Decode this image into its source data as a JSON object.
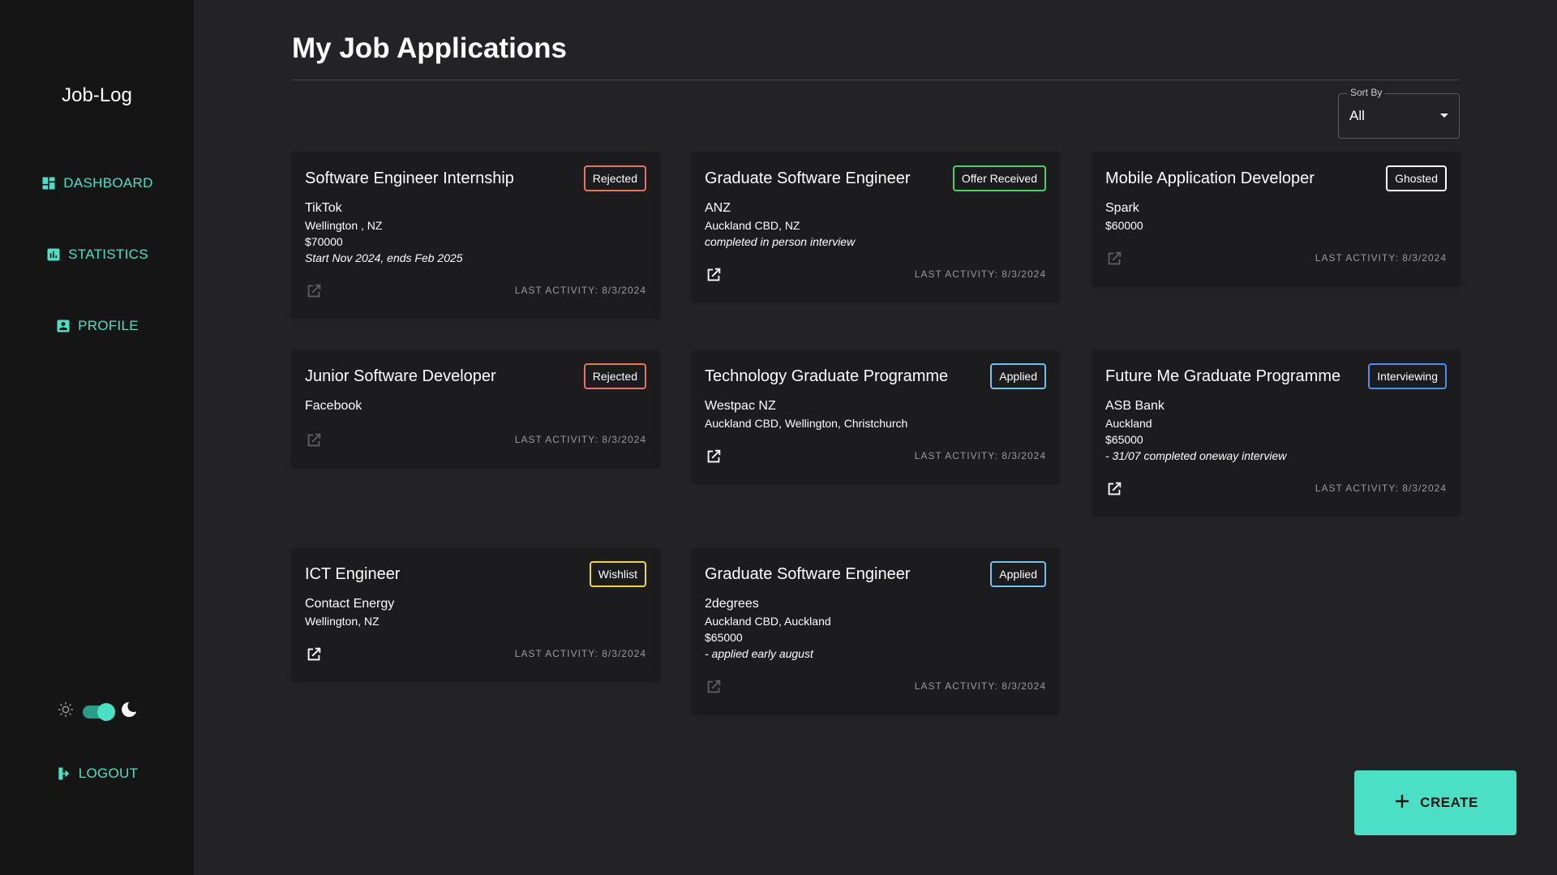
{
  "sidebar": {
    "brand": "Job-Log",
    "nav": [
      {
        "label": "DASHBOARD",
        "icon": "dashboard-icon"
      },
      {
        "label": "STATISTICS",
        "icon": "chart-icon"
      },
      {
        "label": "PROFILE",
        "icon": "account-box-icon"
      }
    ],
    "theme_toggle": {
      "left_icon": "sun-icon",
      "right_icon": "moon-icon",
      "dark_mode": true
    },
    "logout": {
      "label": "LOGOUT",
      "icon": "logout-icon"
    }
  },
  "main": {
    "title": "My Job Applications",
    "sort": {
      "label": "Sort By",
      "value": "All"
    }
  },
  "colors": {
    "accent": "#4be0c6",
    "rejected": "#e57560",
    "offer": "#4fd06a",
    "ghosted": "#ffffff",
    "applied": "#6fc2ee",
    "interviewing": "#4a8ff0",
    "wishlist": "#f3d23a"
  },
  "cards": [
    {
      "title": "Software Engineer Internship",
      "status": "Rejected",
      "company": "TikTok",
      "details": [
        "Wellington , NZ",
        "$70000",
        "Start Nov 2024, ends Feb 2025"
      ],
      "link_active": false,
      "last_activity": "LAST ACTIVITY: 8/3/2024"
    },
    {
      "title": "Graduate Software Engineer",
      "status": "Offer Received",
      "company": "ANZ",
      "details": [
        "Auckland CBD, NZ",
        "completed in person interview"
      ],
      "link_active": true,
      "last_activity": "LAST ACTIVITY: 8/3/2024"
    },
    {
      "title": "Mobile Application Developer",
      "status": "Ghosted",
      "company": "Spark",
      "details": [
        "$60000"
      ],
      "link_active": false,
      "last_activity": "LAST ACTIVITY: 8/3/2024"
    },
    {
      "title": "Junior Software Developer",
      "status": "Rejected",
      "company": "Facebook",
      "details": [],
      "link_active": false,
      "last_activity": "LAST ACTIVITY: 8/3/2024"
    },
    {
      "title": "Technology Graduate Programme",
      "status": "Applied",
      "company": "Westpac NZ",
      "details": [
        "Auckland CBD, Wellington, Christchurch"
      ],
      "link_active": true,
      "last_activity": "LAST ACTIVITY: 8/3/2024"
    },
    {
      "title": "Future Me Graduate Programme",
      "status": "Interviewing",
      "company": "ASB Bank",
      "details": [
        "Auckland",
        "$65000",
        "- 31/07 completed oneway interview"
      ],
      "link_active": true,
      "last_activity": "LAST ACTIVITY: 8/3/2024"
    },
    {
      "title": "ICT Engineer",
      "status": "Wishlist",
      "company": "Contact Energy",
      "details": [
        "Wellington, NZ"
      ],
      "link_active": true,
      "last_activity": "LAST ACTIVITY: 8/3/2024"
    },
    {
      "title": "Graduate Software Engineer",
      "status": "Applied",
      "company": "2degrees",
      "details": [
        "Auckland CBD, Auckland",
        "$65000",
        "- applied early august"
      ],
      "link_active": false,
      "last_activity": "LAST ACTIVITY: 8/3/2024"
    }
  ],
  "create_button": {
    "label": "CREATE",
    "icon": "plus-icon"
  }
}
